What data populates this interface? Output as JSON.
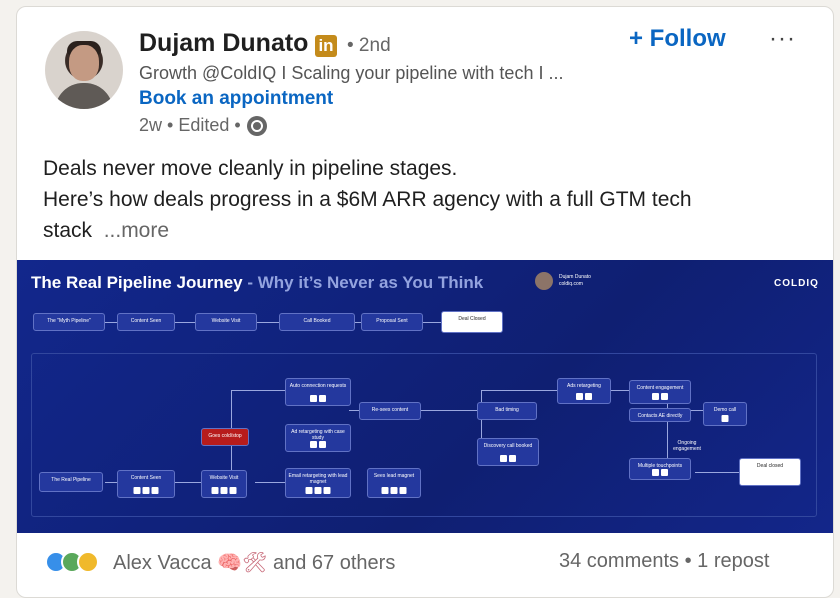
{
  "author": {
    "name": "Dujam Dunato",
    "li_badge": "in",
    "degree": "• 2nd",
    "headline": "Growth @ColdIQ I Scaling your pipeline with tech I ...",
    "cta": "Book an appointment",
    "meta": "2w • Edited •"
  },
  "actions": {
    "follow": "+ Follow",
    "more": "···"
  },
  "post": {
    "line1": "Deals never move cleanly in pipeline stages.",
    "line2": "Here’s how deals progress in a $6M ARR agency with a full GTM tech",
    "line3": "stack",
    "see_more": "...more"
  },
  "infographic": {
    "title": "The Real Pipeline Journey",
    "subtitle": " - Why it’s Never as You Think",
    "brand": "COLDIQ",
    "author_mini_name": "Dujam Dunato",
    "author_mini_handle": "coldiq.com",
    "myth_label": "The \"Myth Pipeline\"",
    "myth_steps": [
      "Content Seen",
      "Website Visit",
      "Call Booked",
      "Proposal Sent",
      "Deal Closed"
    ],
    "real_label": "The Real Pipeline",
    "real_steps": {
      "content_seen": "Content Seen",
      "website_visit": "Website Visit",
      "goes_cold": "Goes cold/stop",
      "auto_reconnect": "Auto connection requests",
      "ad_retarget": "Ad retargeting with case study",
      "email_retarget": "Email retargeting with lead magnet",
      "re_sees": "Re-sees content",
      "sees_lead": "Sees lead magnet",
      "bad_timing": "Bad timing",
      "discovery": "Discovery call booked",
      "ads_retarget": "Ads retargeting",
      "content_engagement": "Content engagement",
      "contacts_ae": "Contacts AE directly",
      "demo_call": "Demo call",
      "ongoing": "Ongoing engagement",
      "multiple": "Multiple touchpoints",
      "deal_closed": "Deal closed"
    }
  },
  "social": {
    "likes": "Alex Vacca",
    "likes_suffix": "and 67 others",
    "emojis": "🧠🛠",
    "stats": "34 comments • 1 repost"
  }
}
